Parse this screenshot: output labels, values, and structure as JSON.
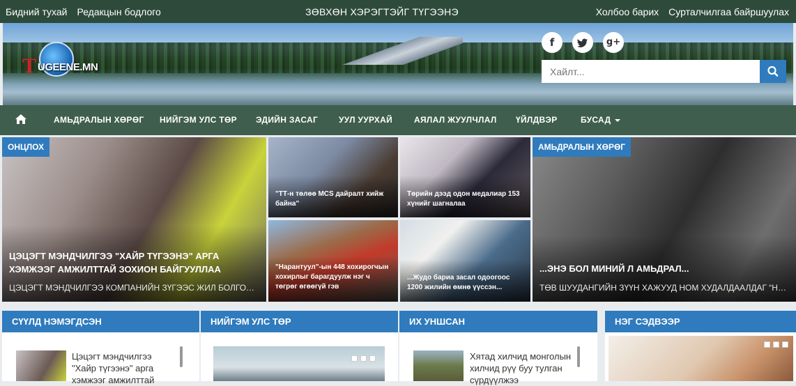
{
  "topbar": {
    "about": "Бидний тухай",
    "editorial": "Редакцын бодлого",
    "tagline": "ЗӨВХӨН ХЭРЭГТЭЙГ ТҮГЭЭНЭ",
    "contact": "Холбоо барих",
    "correspondents": "Сурталчилгаа байршуулах"
  },
  "logo": {
    "letter": "T",
    "text": "UGEENE.MN"
  },
  "social": {
    "facebook": "f",
    "twitter": "t",
    "google": "g+"
  },
  "search": {
    "placeholder": "Хайлт..."
  },
  "nav": {
    "items": [
      "АМЬДРАЛЫН ХӨРӨГ",
      "НИЙГЭМ УЛС ТӨР",
      "ЭДИЙН ЗАСАГ",
      "УУЛ УУРХАЙ",
      "АЯЛАЛ ЖУУЛЧЛАЛ",
      "ҮЙЛДВЭР",
      "БУСАД"
    ]
  },
  "featured": {
    "main": {
      "tag": "ОНЦЛОХ",
      "title": "ЦЭЦЭГТ МЭНДЧИЛГЭЭ \"ХАЙР ТҮГЭЭНЭ\" АРГА ХЭМЖЭЭГ АМЖИЛТТАЙ ЗОХИОН БАЙГУУЛЛАА",
      "subtitle": "ЦЭЦЭГТ МЭНДЧИЛГЭЭ КОМПАНИЙН ЗҮГЭЭС ЖИЛ БОЛГОН НИ..."
    },
    "small": [
      {
        "title": "\"ТТ-н төлөө MCS дайралт хийж байна\""
      },
      {
        "title": "Төрийн дээд одон медалиар 153 хүнийг шагналаа"
      },
      {
        "title": "\"Нарантуул\"-ын 448 хохирогчын хохирлыг барагдуулж нэг ч төгрөг өгөөгүй гэв"
      },
      {
        "title": "...Жудо бариа засал одоогоос 1200 жилийн өмнө үүссэн..."
      }
    ],
    "right": {
      "tag": "АМЬДРАЛЫН ХӨРӨГ",
      "title": "...ЭНЭ БОЛ МИНИЙ Л АМЬДРАЛ...",
      "subtitle": "ТӨВ ШУУДАНГИЙН ЗҮҮН ХАЖУУД НОМ ХУДАЛДААЛДАГ “НОМ..."
    }
  },
  "panels": {
    "latest": {
      "title": "СҮҮЛД НЭМЭГДСЭН",
      "item": "Цэцэгт мэндчилгээ \"Хайр түгээнэ\" арга хэмжээг амжилттай"
    },
    "society": {
      "title": "НИЙГЭМ УЛС ТӨР"
    },
    "popular": {
      "title": "ИХ УНШСАН",
      "item": "Хятад хилчид монголын хилчид рүү буу тулган сүрдүүлжээ"
    },
    "topic": {
      "title": "НЭГ СЭДВЭЭР"
    }
  }
}
